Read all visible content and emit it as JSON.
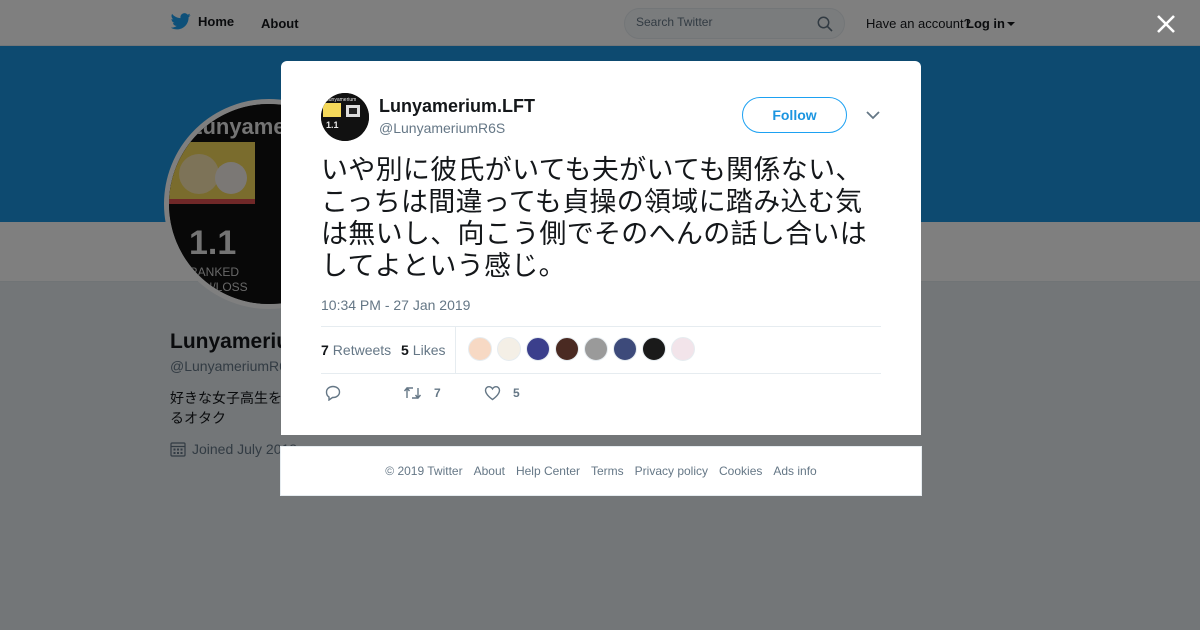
{
  "topbar": {
    "home_label": "Home",
    "about_label": "About",
    "search_placeholder": "Search Twitter",
    "have_account": "Have an account?",
    "login_label": "Log in"
  },
  "profile": {
    "name": "Lunyamerium",
    "handle": "@LunyameriumR6",
    "bio": "好きな女子高生を いるオタク",
    "joined": "Joined July 2018"
  },
  "tweet": {
    "display_name": "Lunyamerium.LFT",
    "handle": "@LunyameriumR6S",
    "follow_label": "Follow",
    "text": "いや別に彼氏がいても夫がいても関係ない、こっちは間違っても貞操の領域に踏み込む気は無いし、向こう側でそのへんの話し合いはしてよという感じ。",
    "timestamp": "10:34 PM - 27 Jan 2019",
    "retweets_count": "7",
    "retweets_label": "Retweets",
    "likes_count": "5",
    "likes_label": "Likes",
    "action_retweet_count": "7",
    "action_like_count": "5",
    "liker_colors": [
      "#f7d9c4",
      "#f4efe6",
      "#3b3f8c",
      "#4a2a22",
      "#9a9a9a",
      "#3d4a7a",
      "#1a1a1a",
      "#f2e4ea"
    ]
  },
  "footer": {
    "copyright": "© 2019 Twitter",
    "links": [
      "About",
      "Help Center",
      "Terms",
      "Privacy policy",
      "Cookies",
      "Ads info"
    ]
  },
  "colors": {
    "brand": "#1da1f2",
    "banner": "#1b95e0",
    "muted": "#657786"
  }
}
